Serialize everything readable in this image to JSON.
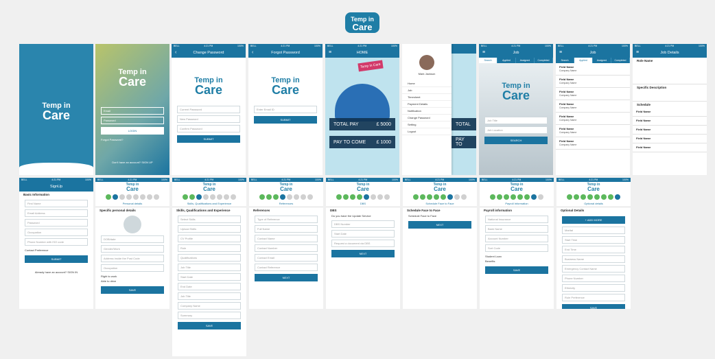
{
  "logo": {
    "line1": "Temp in",
    "line2": "Care"
  },
  "status": {
    "carrier": "BELL",
    "time": "4:21 PM",
    "battery": "100%"
  },
  "splash": {
    "line1": "Temp in",
    "line2": "Care"
  },
  "login": {
    "line1": "Temp in",
    "line2": "Care",
    "email": "Email",
    "password": "Password",
    "login": "LOGIN",
    "forgot": "Forgot Password?",
    "signup_prompt": "Don't have an account?",
    "signup_link": "SIGN UP"
  },
  "change_pw": {
    "title": "Change Password",
    "current": "Current Password",
    "new": "New Password",
    "confirm": "Confirm Password",
    "submit": "SUBMIT"
  },
  "forgot_pw": {
    "title": "Forgot Password",
    "email": "Enter Email ID",
    "submit": "SUBMIT"
  },
  "home": {
    "title": "HOME",
    "sign": "Temp in Care",
    "total_label": "TOTAL PAY",
    "total_val": "£ 5000",
    "come_label": "PAY TO COME",
    "come_val": "£ 1000"
  },
  "menu": {
    "name": "Mark Jackson",
    "items": [
      "Home",
      "Job",
      "Timesheet",
      "Payment Details",
      "Notification",
      "Change Password",
      "Setting",
      "Logout"
    ],
    "peek1": "TOTAL",
    "peek2": "PAY TO"
  },
  "job_search": {
    "title": "Job",
    "tabs": [
      "Search",
      "Applied",
      "Assigned",
      "Completed"
    ],
    "field1": "Job Title",
    "field2": "Job Location",
    "search": "SEARCH"
  },
  "job_list": {
    "title": "Job",
    "tabs": [
      "Search",
      "Applied",
      "Assigned",
      "Completed"
    ],
    "item_title": "Field Name",
    "item_sub": "Company Name"
  },
  "job_details": {
    "title": "Job Details",
    "s1": "Role Name",
    "s2": "Specific Description",
    "s3": "Schedule",
    "row": "Field Name"
  },
  "signup": {
    "title": "SignUp",
    "heading": "Basic Information",
    "fields": [
      "First Name",
      "Email Address",
      "Password",
      "Occupation",
      "Phone Number with ISO code"
    ],
    "contact": "Contact Preference",
    "submit": "SUBMIT",
    "have_account": "Already have an account?",
    "signin": "SIGN IN"
  },
  "personal": {
    "section": "Personal details",
    "heading": "Specific personal details",
    "fields": [
      "DOB/date",
      "Gender/Work",
      "Address inside the Post Code",
      "Occupation"
    ],
    "right_work": "Right to work",
    "able_drive": "Able to drive",
    "save": "SAVE"
  },
  "skills": {
    "section": "Skills, Qualifications and Experience",
    "heading": "Skills, Qualifications and Experience",
    "fields": [
      "Select Skills",
      "Upload Skills",
      "CV Profile",
      "Role",
      "Qualifications",
      "Job Title",
      "Start Date",
      "End Date",
      "Job Title",
      "Company Name",
      "Summary"
    ],
    "save": "SAVE"
  },
  "references": {
    "section": "References",
    "heading": "References",
    "fields": [
      "Type of Reference",
      "Full Name",
      "Contact Name",
      "Contact Number",
      "Contact Email",
      "Contact Reference"
    ],
    "next": "NEXT"
  },
  "dbs": {
    "section": "DBS",
    "heading": "DBS",
    "question": "Do you have the Update Service",
    "fields": [
      "DBS Number",
      "Start Date",
      "Request a document via DBS"
    ],
    "next": "NEXT"
  },
  "f2f": {
    "section": "Schedule Face to Face",
    "heading": "Schedule Face to Face",
    "question": "Schedule Face to Face",
    "next": "NEXT"
  },
  "payroll": {
    "section": "Payroll Information",
    "heading": "Payroll information",
    "fields": [
      "National Insurance",
      "Bank Name",
      "Account Number",
      "Sort Code"
    ],
    "student": "Student Loan",
    "benefits": "Benefits",
    "save": "SAVE"
  },
  "optional": {
    "section": "Optional details",
    "heading": "Optional Details",
    "fields": [
      "Marital",
      "Start Time",
      "End Time",
      "Business Name",
      "Emergency Contact Name",
      "Phone Number",
      "Ethnicity",
      "Role Preference"
    ],
    "add": "+ ADD MORE",
    "save": "SAVE"
  }
}
